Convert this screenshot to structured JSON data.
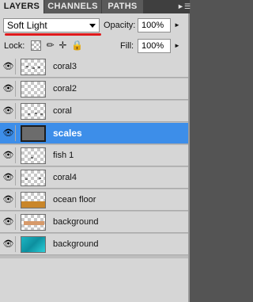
{
  "tabs": [
    {
      "label": "LAYERS"
    },
    {
      "label": "CHANNELS"
    },
    {
      "label": "PATHS"
    }
  ],
  "tab_menu_icon": "double-arrow-menu-icon",
  "blend_mode": {
    "value": "Soft Light"
  },
  "opacity": {
    "label": "Opacity:",
    "value": "100%"
  },
  "lock": {
    "label": "Lock:"
  },
  "fill": {
    "label": "Fill:",
    "value": "100%"
  },
  "accent_color": "#3d8ee9",
  "annotation_color": "#e0191c",
  "layers": [
    {
      "name": "coral3",
      "thumb": "transparent-dots",
      "selected": false
    },
    {
      "name": "coral2",
      "thumb": "transparent",
      "selected": false
    },
    {
      "name": "coral",
      "thumb": "transparent-dots",
      "selected": false
    },
    {
      "name": "scales",
      "thumb": "dark",
      "selected": true
    },
    {
      "name": "fish 1",
      "thumb": "transparent-dots",
      "selected": false
    },
    {
      "name": "coral4",
      "thumb": "transparent-dots",
      "selected": false
    },
    {
      "name": "ocean floor",
      "thumb": "sand",
      "selected": false
    },
    {
      "name": "background",
      "thumb": "stripe",
      "selected": false
    },
    {
      "name": "background",
      "thumb": "water",
      "selected": false
    }
  ]
}
